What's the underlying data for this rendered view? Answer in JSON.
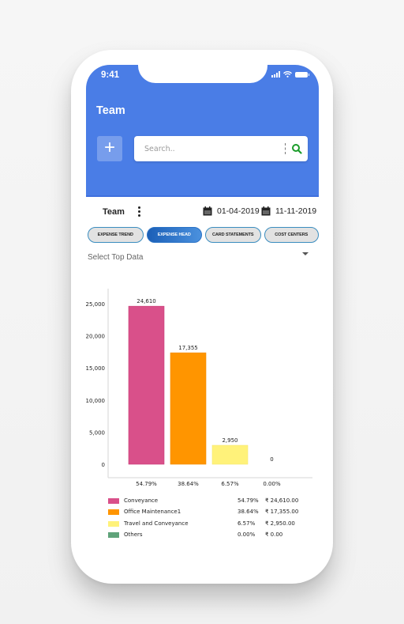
{
  "status_bar": {
    "time": "9:41"
  },
  "header": {
    "title": "Team",
    "add_button_label": "+",
    "search_placeholder": "Search.."
  },
  "toolbar": {
    "team_label": "Team",
    "date_from": "01-04-2019",
    "date_to": "11-11-2019"
  },
  "tabs": [
    {
      "label": "Expense Trend",
      "active": false
    },
    {
      "label": "Expense Head",
      "active": true
    },
    {
      "label": "Card Statements",
      "active": false
    },
    {
      "label": "Cost Centers",
      "active": false
    }
  ],
  "select_top": {
    "label": "Select Top Data"
  },
  "chart_data": {
    "type": "bar",
    "title": "",
    "xlabel": "",
    "ylabel": "",
    "categories": [
      "Conveyance",
      "Office Maintenance1",
      "Travel and Conveyance",
      "Others"
    ],
    "values": [
      24610,
      17355,
      2950,
      0
    ],
    "value_labels": [
      "24,610",
      "17,355",
      "2,950",
      "0"
    ],
    "percent_labels": [
      "54.79%",
      "38.64%",
      "6.57%",
      "0.00%"
    ],
    "colors": [
      "#d9508a",
      "#ff9500",
      "#fff27a",
      "#5fa37a"
    ],
    "ylim": [
      0,
      25000
    ],
    "yticks": [
      0,
      5000,
      10000,
      15000,
      20000,
      25000
    ],
    "ytick_labels": [
      "0",
      "5,000",
      "10,000",
      "15,000",
      "20,000",
      "25,000"
    ],
    "grid": false,
    "legend": "bottom"
  },
  "legend": [
    {
      "name": "Conveyance",
      "percent": "54.79%",
      "amount": "₹ 24,610.00",
      "color": "#d9508a"
    },
    {
      "name": "Office Maintenance1",
      "percent": "38.64%",
      "amount": "₹ 17,355.00",
      "color": "#ff9500"
    },
    {
      "name": "Travel and Conveyance",
      "percent": "6.57%",
      "amount": "₹ 2,950.00",
      "color": "#fff27a"
    },
    {
      "name": "Others",
      "percent": "0.00%",
      "amount": "₹ 0.00",
      "color": "#5fa37a"
    }
  ],
  "colors": {
    "header": "#4a7de6",
    "search_icon": "#1a9c2a",
    "active_tab": "#1b5fb7"
  }
}
